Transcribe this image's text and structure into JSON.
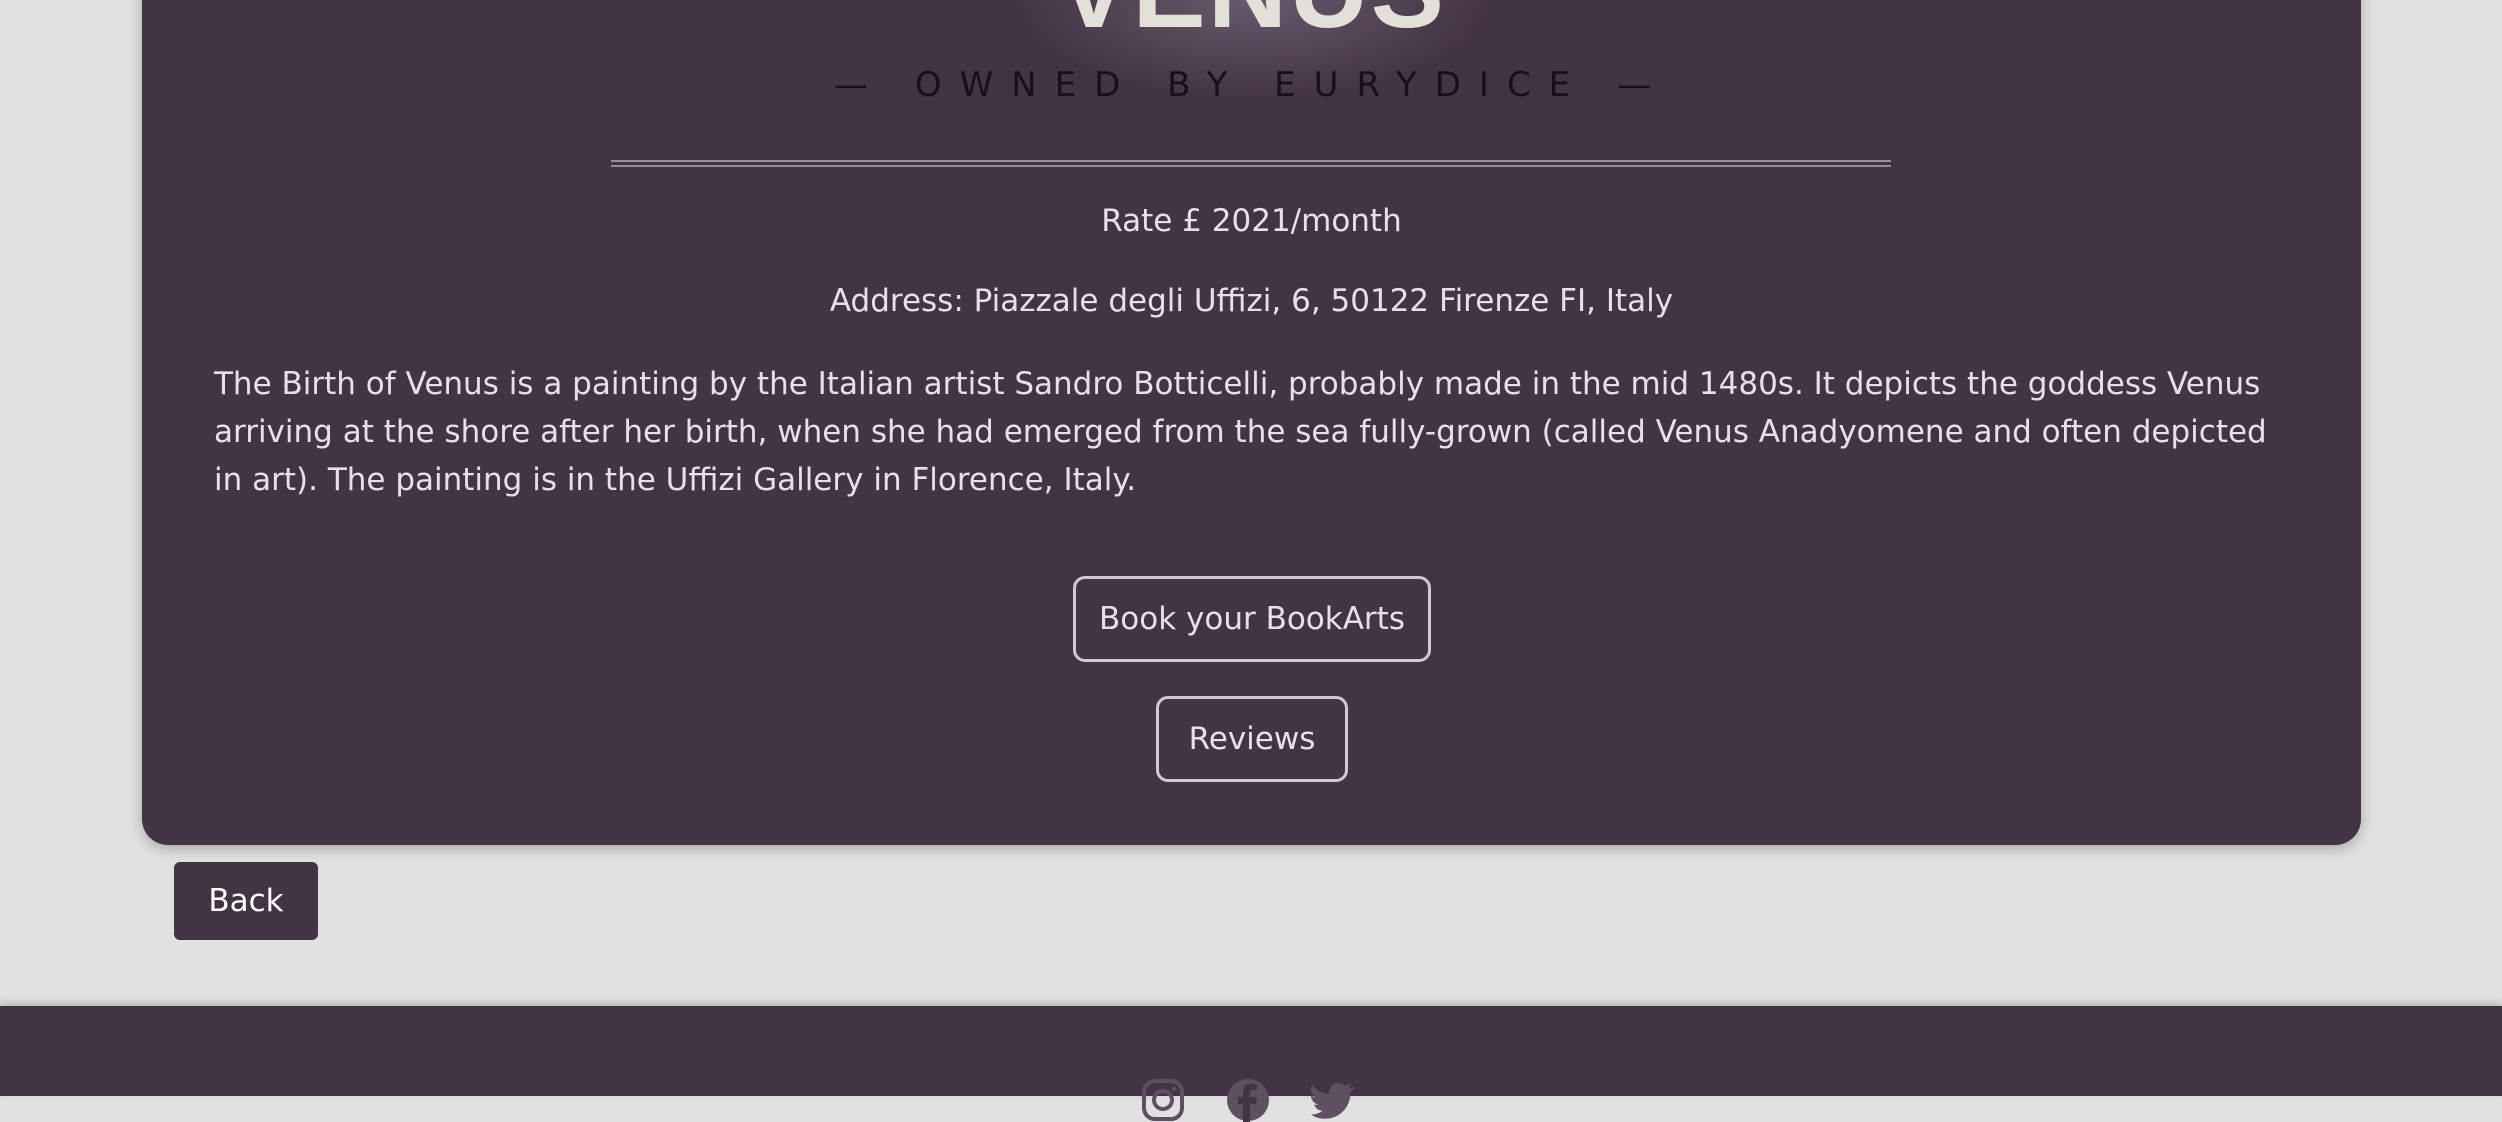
{
  "artwork": {
    "title": "VENUS",
    "owner_line": "— OWNED BY EURYDICE —",
    "rate": "Rate £ 2021/month",
    "address": "Address: Piazzale degli Uffizi, 6, 50122 Firenze FI, Italy",
    "description": "The Birth of Venus is a painting by the Italian artist Sandro Botticelli, probably made in the mid 1480s. It depicts the goddess Venus arriving at the shore after her birth, when she had emerged from the sea fully-grown (called Venus Anadyomene and often depicted in art). The painting is in the Uffizi Gallery in Florence, Italy."
  },
  "actions": {
    "book_label": "Book your BookArts",
    "reviews_label": "Reviews",
    "back_label": "Back"
  },
  "footer": {
    "social_icons": [
      "instagram-icon",
      "facebook-icon",
      "twitter-icon"
    ]
  },
  "colors": {
    "card_bg": "#433444",
    "page_bg": "#e1e1e1",
    "text": "#e5e1e6"
  }
}
